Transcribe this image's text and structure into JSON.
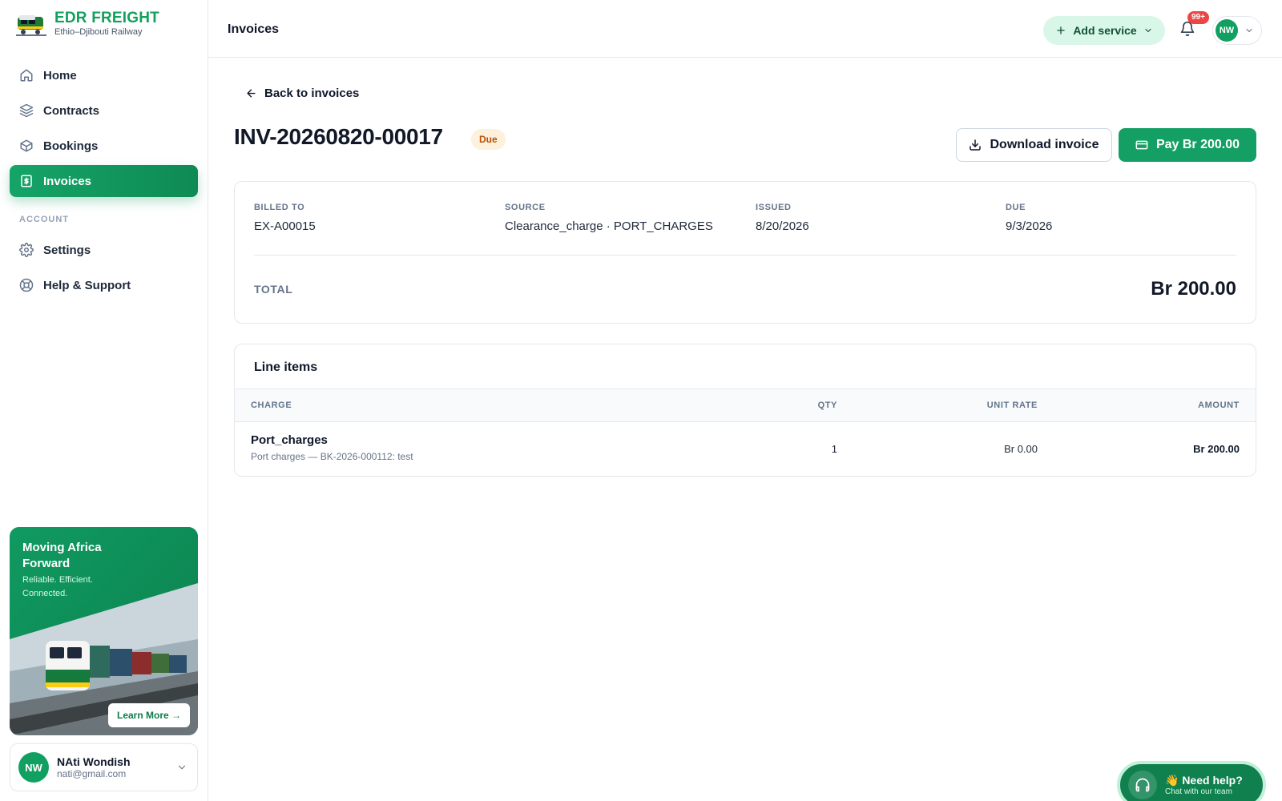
{
  "brand": {
    "title": "EDR FREIGHT",
    "subtitle": "Ethio–Djibouti Railway"
  },
  "sidebar": {
    "items": [
      {
        "label": "Home",
        "icon": "home-icon"
      },
      {
        "label": "Contracts",
        "icon": "layers-icon"
      },
      {
        "label": "Bookings",
        "icon": "box-icon"
      },
      {
        "label": "Invoices",
        "icon": "invoice-icon",
        "active": true
      }
    ],
    "section_label": "ACCOUNT",
    "account_items": [
      {
        "label": "Settings",
        "icon": "gear-icon"
      },
      {
        "label": "Help & Support",
        "icon": "lifebuoy-icon"
      }
    ],
    "promo": {
      "title": "Moving Africa Forward",
      "subtitle": "Reliable. Efficient. Connected.",
      "button": "Learn More →"
    },
    "user": {
      "initials": "NW",
      "name": "NAti Wondish",
      "email": "nati@gmail.com"
    }
  },
  "topbar": {
    "title": "Invoices",
    "add_service": "Add service",
    "notification_count": "99+",
    "avatar_initials": "NW"
  },
  "invoice": {
    "back_label": "Back to invoices",
    "number": "INV-20260820-00017",
    "status": "Due",
    "download_label": "Download invoice",
    "pay_label": "Pay Br 200.00",
    "meta": [
      {
        "label": "BILLED TO",
        "value": "EX-A00015"
      },
      {
        "label": "SOURCE",
        "value": "Clearance_charge · PORT_CHARGES"
      },
      {
        "label": "ISSUED",
        "value": "8/20/2026"
      },
      {
        "label": "DUE",
        "value": "9/3/2026"
      }
    ],
    "total_label": "TOTAL",
    "total_value": "Br 200.00"
  },
  "line_items": {
    "title": "Line items",
    "columns": [
      "CHARGE",
      "QTY",
      "UNIT RATE",
      "AMOUNT"
    ],
    "rows": [
      {
        "name": "Port_charges",
        "description": "Port charges — BK-2026-000112: test",
        "qty": "1",
        "unit_rate": "Br 0.00",
        "amount": "Br 200.00"
      }
    ]
  },
  "help": {
    "title": "👋 Need help?",
    "subtitle": "Chat with our team"
  },
  "colors": {
    "primary": "#14a064",
    "accent_light": "#d9f7e8",
    "badge_due_bg": "#fdf1dc",
    "badge_due_text": "#b45309",
    "notification": "#ef4444"
  }
}
